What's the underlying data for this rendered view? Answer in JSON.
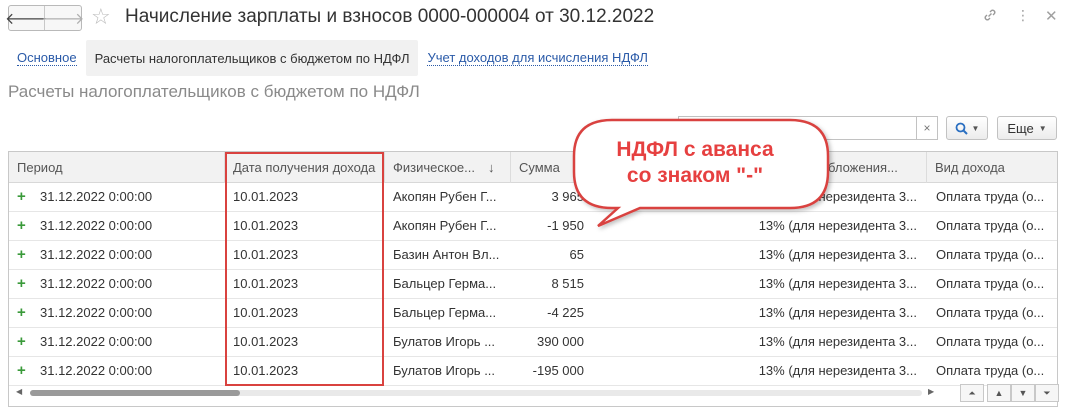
{
  "window": {
    "title": "Начисление зарплаты и взносов 0000-000004 от 30.12.2022",
    "back_icon": "arrow-left-icon",
    "forward_icon": "arrow-right-icon",
    "favorite_icon": "star-icon",
    "link_icon": "link-icon",
    "menu_icon": "more-vertical-icon",
    "close_icon": "close-icon"
  },
  "tabs": [
    {
      "label": "Основное",
      "active": false
    },
    {
      "label": "Расчеты налогоплательщиков с бюджетом по НДФЛ",
      "active": true
    },
    {
      "label": "Учет доходов для исчисления НДФЛ",
      "active": false
    }
  ],
  "section_title": "Расчеты налогоплательщиков с бюджетом по НДФЛ",
  "search": {
    "value": "",
    "clear_glyph": "×"
  },
  "more_button": {
    "label": "Еще"
  },
  "table": {
    "columns": [
      "Период",
      "Дата получения дохода",
      "Физическое...",
      "Сумма",
      "",
      "...огообложения...",
      "Вид дохода"
    ],
    "sort_glyph": "↓",
    "rows": [
      {
        "period": "31.12.2022 0:00:00",
        "date": "10.01.2023",
        "person": "Акопян Рубен Г...",
        "amount": "3 965",
        "rate": "13% (для нерезидента 3...",
        "income": "Оплата труда (о..."
      },
      {
        "period": "31.12.2022 0:00:00",
        "date": "10.01.2023",
        "person": "Акопян Рубен Г...",
        "amount": "-1 950",
        "rate": "13% (для нерезидента 3...",
        "income": "Оплата труда (о..."
      },
      {
        "period": "31.12.2022 0:00:00",
        "date": "10.01.2023",
        "person": "Базин Антон Вл...",
        "amount": "65",
        "rate": "13% (для нерезидента 3...",
        "income": "Оплата труда (о..."
      },
      {
        "period": "31.12.2022 0:00:00",
        "date": "10.01.2023",
        "person": "Бальцер Герма...",
        "amount": "8 515",
        "rate": "13% (для нерезидента 3...",
        "income": "Оплата труда (о..."
      },
      {
        "period": "31.12.2022 0:00:00",
        "date": "10.01.2023",
        "person": "Бальцер Герма...",
        "amount": "-4 225",
        "rate": "13% (для нерезидента 3...",
        "income": "Оплата труда (о..."
      },
      {
        "period": "31.12.2022 0:00:00",
        "date": "10.01.2023",
        "person": "Булатов Игорь ...",
        "amount": "390 000",
        "rate": "13% (для нерезидента 3...",
        "income": "Оплата труда (о..."
      },
      {
        "period": "31.12.2022 0:00:00",
        "date": "10.01.2023",
        "person": "Булатов Игорь ...",
        "amount": "-195 000",
        "rate": "13% (для нерезидента 3...",
        "income": "Оплата труда (о..."
      }
    ]
  },
  "callout": {
    "line1": "НДФЛ с аванса",
    "line2": "со знаком \"-\""
  },
  "colors": {
    "accent_red": "#d9423f",
    "callout_text": "#e64040",
    "link_blue": "#2a5aa8",
    "plus_green": "#3a9a3a"
  }
}
